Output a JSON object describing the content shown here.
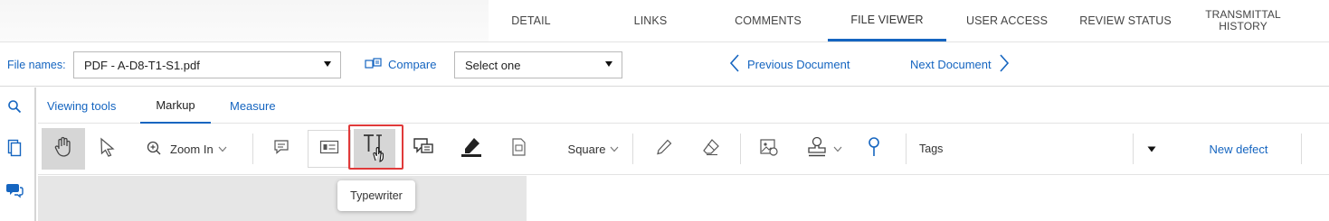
{
  "nav": {
    "tabs": [
      {
        "label": "DETAIL"
      },
      {
        "label": "LINKS"
      },
      {
        "label": "COMMENTS"
      },
      {
        "label": "FILE VIEWER",
        "active": true
      },
      {
        "label": "USER ACCESS"
      },
      {
        "label": "REVIEW STATUS"
      },
      {
        "label_line1": "TRANSMITTAL",
        "label_line2": "HISTORY"
      }
    ]
  },
  "filebar": {
    "file_names_label": "File names:",
    "file_select_value": "PDF - A-D8-T1-S1.pdf",
    "compare_label": "Compare",
    "compare_select_value": "Select one",
    "previous_document": "Previous Document",
    "next_document": "Next Document"
  },
  "viewer": {
    "subtabs": [
      {
        "label": "Viewing tools"
      },
      {
        "label": "Markup",
        "active": true
      },
      {
        "label": "Measure"
      }
    ],
    "toolbar": {
      "zoom_label": "Zoom In",
      "shape_label": "Square",
      "tags_label": "Tags",
      "new_defect_label": "New defect"
    },
    "tooltip": "Typewriter"
  },
  "icons": {
    "rail": [
      "search-icon",
      "pages-icon",
      "comments-icon"
    ],
    "tools": [
      "pan-hand-icon",
      "select-arrow-icon",
      "zoom-in-icon",
      "sticky-note-icon",
      "text-box-icon",
      "typewriter-icon",
      "callout-icon",
      "highlighter-icon",
      "stamp-box-icon",
      "pencil-icon",
      "eraser-icon",
      "image-stamp-icon",
      "stamp-icon",
      "pin-icon"
    ]
  },
  "colors": {
    "accent": "#1565c0",
    "highlight_border": "#e03a3a",
    "selected_tool_bg": "#d6d6d6"
  }
}
